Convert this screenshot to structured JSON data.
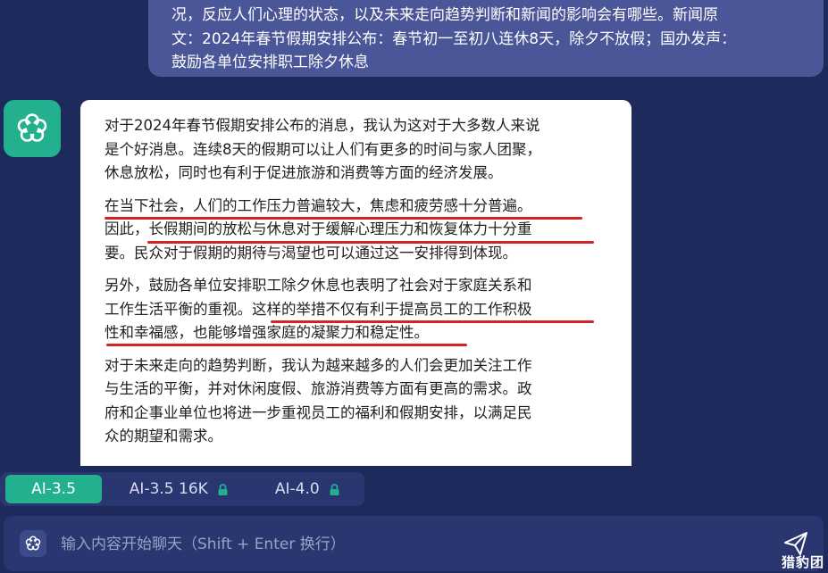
{
  "user_message": {
    "lines": [
      "况，反应人们心理的状态，以及未来走向趋势判断和新闻的影响会有哪些。新闻原",
      "文：2024年春节假期安排公布：春节初一至初八连休8天，除夕不放假；国办发声：",
      "鼓励各单位安排职工除夕休息"
    ]
  },
  "ai_message": {
    "paragraphs": [
      {
        "lines": [
          "对于2024年春节假期安排公布的消息，我认为这对于大多数人来说",
          "是个好消息。连续8天的假期可以让人们有更多的时间与家人团聚，",
          "休息放松，同时也有利于促进旅游和消费等方面的经济发展。"
        ]
      },
      {
        "lines": [
          "在当下社会，人们的工作压力普遍较大，焦虑和疲劳感十分普遍。",
          "因此，长假期间的放松与休息对于缓解心理压力和恢复体力十分重",
          "要。民众对于假期的期待与渴望也可以通过这一安排得到体现。"
        ]
      },
      {
        "lines": [
          "另外，鼓励各单位安排职工除夕休息也表明了社会对于家庭关系和",
          "工作生活平衡的重视。这样的举措不仅有利于提高员工的工作积极",
          "性和幸福感，也能够增强家庭的凝聚力和稳定性。"
        ]
      },
      {
        "lines": [
          "对于未来走向的趋势判断，我认为越来越多的人们会更加关注工作",
          "与生活的平衡，并对休闲度假、旅游消费等方面有更高的需求。政",
          "府和企事业单位也将进一步重视员工的福利和假期安排，以满足民",
          "众的期望和需求。"
        ]
      }
    ]
  },
  "models": [
    {
      "label": "AI-3.5",
      "active": true,
      "locked": false
    },
    {
      "label": "AI-3.5 16K",
      "active": false,
      "locked": true
    },
    {
      "label": "AI-4.0",
      "active": false,
      "locked": true
    }
  ],
  "input": {
    "placeholder": "输入内容开始聊天（Shift + Enter 换行）"
  },
  "watermark": "猎豹团",
  "colors": {
    "accent": "#22b08e",
    "underline": "#d52222",
    "background": "#1f2a5c"
  },
  "icons": {
    "avatar": "flower-icon",
    "input": "flower-icon",
    "send": "paper-plane-icon",
    "lock": "lock-icon"
  }
}
